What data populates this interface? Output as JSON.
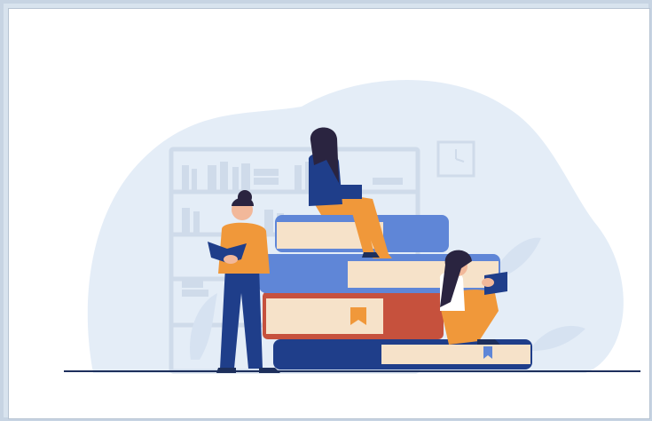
{
  "illustration": {
    "colors": {
      "background_blob": "#e4edf7",
      "shelf": "#cfdbea",
      "book_orange": "#f0983a",
      "book_blue": "#5f86d7",
      "book_navy": "#1f3e8a",
      "book_red": "#c6513d",
      "skin": "#f2b89a",
      "hair": "#2a2440",
      "pages": "#f6e2c9",
      "ground_line": "#1d2f5c"
    }
  }
}
